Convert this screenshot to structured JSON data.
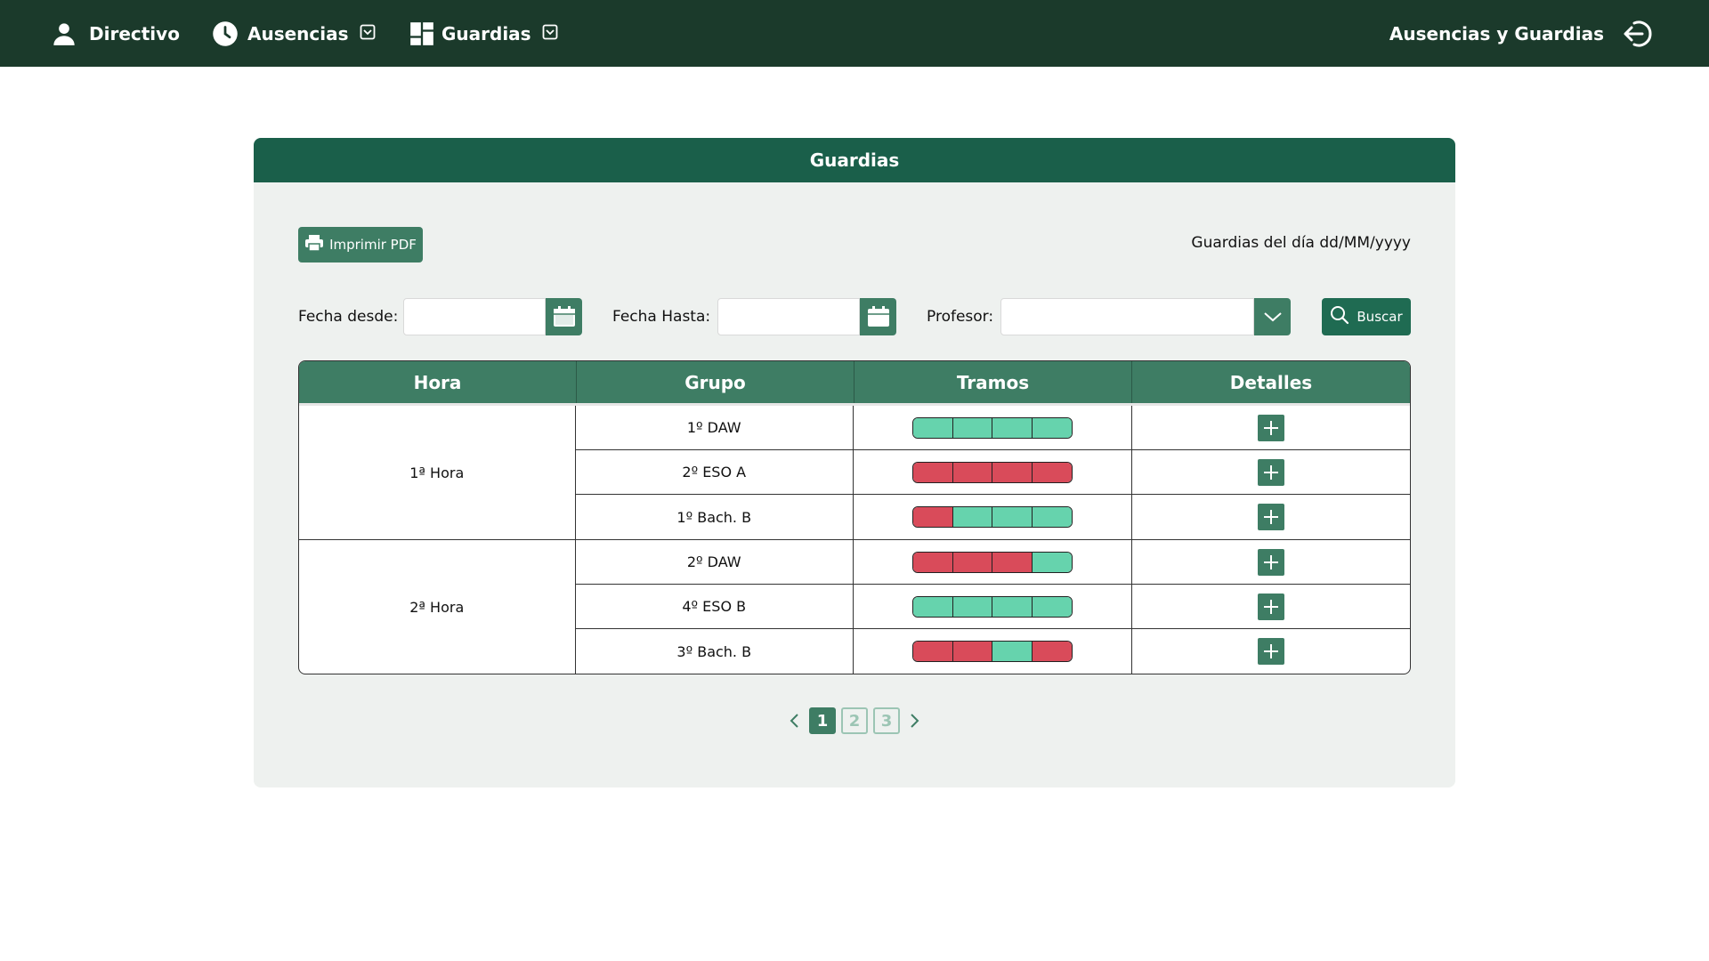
{
  "nav": {
    "directivo": "Directivo",
    "ausencias": "Ausencias",
    "guardias": "Guardias",
    "app_title": "Ausencias y Guardias"
  },
  "card": {
    "title": "Guardias",
    "print_button": "Imprimir PDF",
    "date_caption": "Guardias del día dd/MM/yyyy"
  },
  "filters": {
    "fecha_desde_label": "Fecha desde:",
    "fecha_hasta_label": "Fecha Hasta:",
    "profesor_label": "Profesor:",
    "fecha_desde_value": "",
    "fecha_hasta_value": "",
    "profesor_value": "",
    "buscar": "Buscar"
  },
  "table": {
    "headers": [
      "Hora",
      "Grupo",
      "Tramos",
      "Detalles"
    ],
    "blocks": [
      {
        "hora": "1ª Hora",
        "rows": [
          {
            "grupo": "1º DAW",
            "tramos": [
              "green",
              "green",
              "green",
              "green"
            ]
          },
          {
            "grupo": "2º ESO A",
            "tramos": [
              "red",
              "red",
              "red",
              "red"
            ]
          },
          {
            "grupo": "1º Bach. B",
            "tramos": [
              "red",
              "green",
              "green",
              "green"
            ]
          }
        ]
      },
      {
        "hora": "2ª Hora",
        "rows": [
          {
            "grupo": "2º DAW",
            "tramos": [
              "red",
              "red",
              "red",
              "green"
            ]
          },
          {
            "grupo": "4º ESO B",
            "tramos": [
              "green",
              "green",
              "green",
              "green"
            ]
          },
          {
            "grupo": "3º Bach. B",
            "tramos": [
              "red",
              "red",
              "green",
              "red"
            ]
          }
        ]
      }
    ]
  },
  "pagination": {
    "pages": [
      "1",
      "2",
      "3"
    ],
    "current": "1"
  },
  "colors": {
    "topbar": "#1b3a2b",
    "header": "#1a5f4a",
    "accent": "#3e7d64",
    "tramo_green": "#66d3ad",
    "tramo_red": "#d94b5a"
  }
}
